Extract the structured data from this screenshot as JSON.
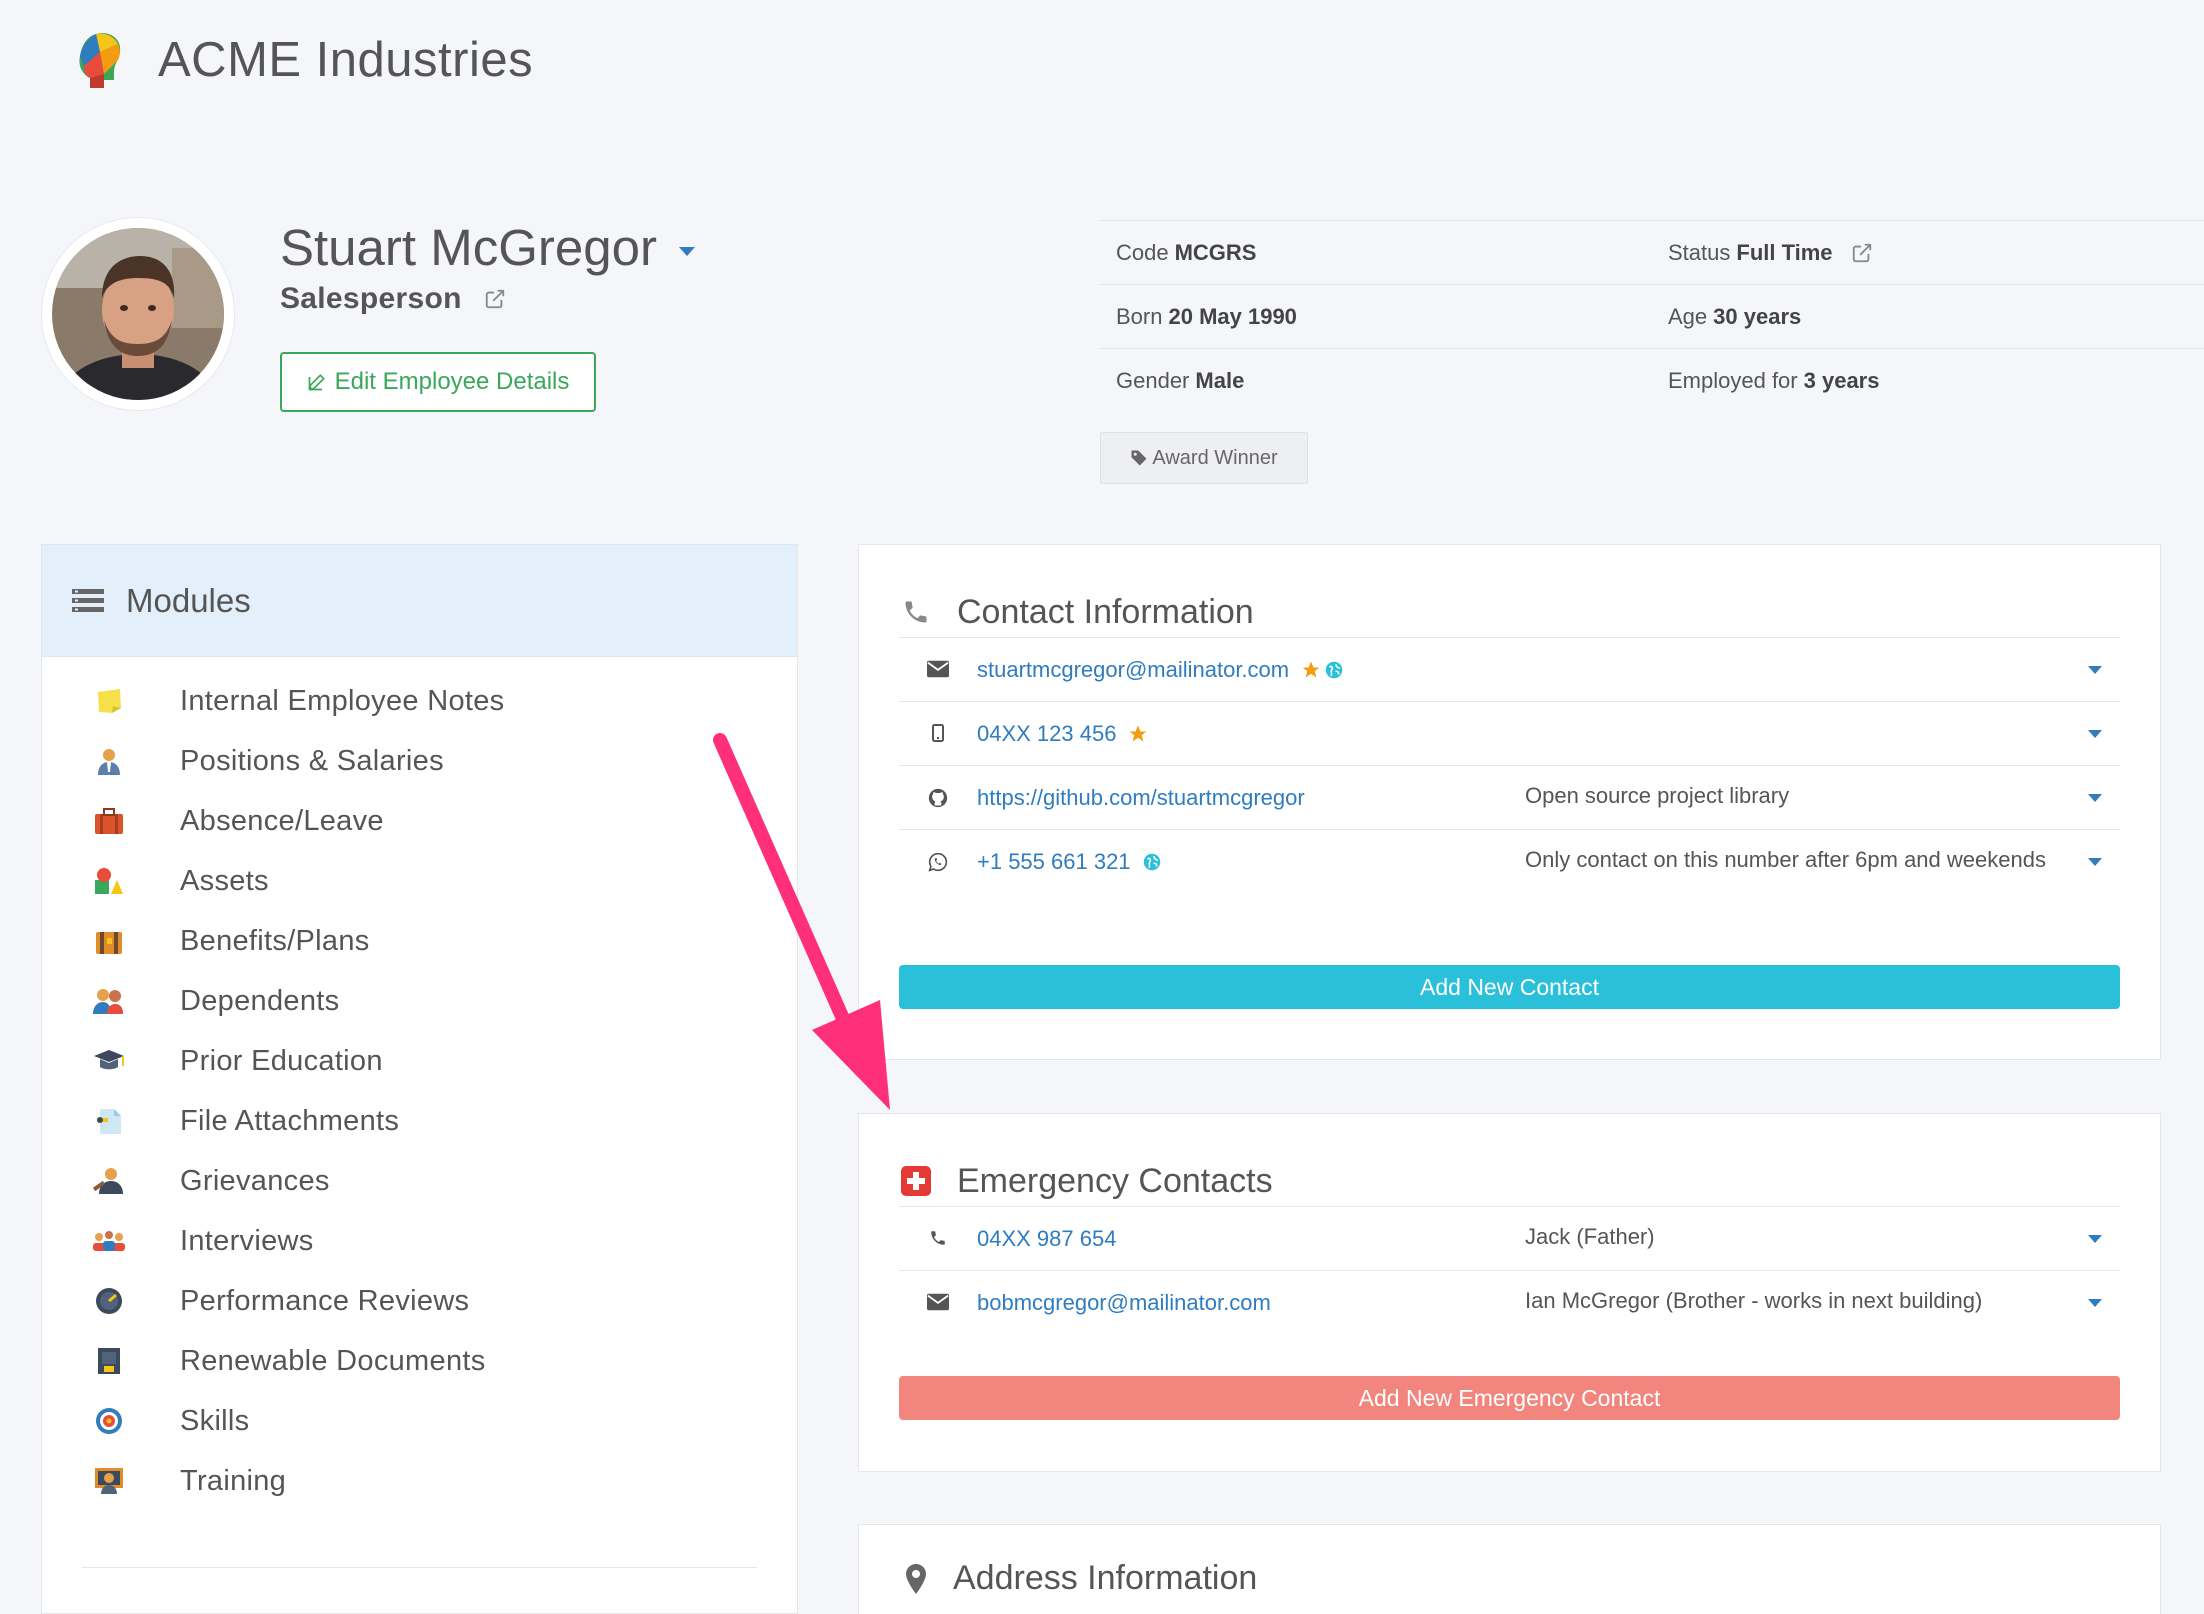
{
  "app": {
    "title": "ACME Industries"
  },
  "employee": {
    "name": "Stuart McGregor",
    "role": "Salesperson",
    "edit_label": "Edit Employee Details"
  },
  "info": {
    "code_label": "Code",
    "code_value": "MCGRS",
    "status_label": "Status",
    "status_value": "Full Time",
    "born_label": "Born",
    "born_value": "20 May 1990",
    "age_label": "Age",
    "age_value": "30 years",
    "gender_label": "Gender",
    "gender_value": "Male",
    "employed_label": "Employed for",
    "employed_value": "3 years",
    "tag": "Award Winner"
  },
  "modules": {
    "title": "Modules",
    "items": [
      {
        "label": "Internal Employee Notes",
        "icon": "sticky-note-icon",
        "color": "#f5e04a"
      },
      {
        "label": "Positions & Salaries",
        "icon": "person-icon",
        "color": "#e8a04a"
      },
      {
        "label": "Absence/Leave",
        "icon": "suitcase-icon",
        "color": "#d9532b"
      },
      {
        "label": "Assets",
        "icon": "blocks-icon",
        "color": "#3aa75a"
      },
      {
        "label": "Benefits/Plans",
        "icon": "chest-icon",
        "color": "#e08c2b"
      },
      {
        "label": "Dependents",
        "icon": "family-icon",
        "color": "#e8a04a"
      },
      {
        "label": "Prior Education",
        "icon": "graduation-cap-icon",
        "color": "#3d4a5c"
      },
      {
        "label": "File Attachments",
        "icon": "attachment-icon",
        "color": "#7fc6e8"
      },
      {
        "label": "Grievances",
        "icon": "judge-icon",
        "color": "#8a5a3a"
      },
      {
        "label": "Interviews",
        "icon": "people-icon",
        "color": "#e8a04a"
      },
      {
        "label": "Performance Reviews",
        "icon": "gauge-icon",
        "color": "#3d4a5c"
      },
      {
        "label": "Renewable Documents",
        "icon": "document-icon",
        "color": "#3d4a5c"
      },
      {
        "label": "Skills",
        "icon": "target-icon",
        "color": "#2f7cbf"
      },
      {
        "label": "Training",
        "icon": "teacher-icon",
        "color": "#e08c2b"
      }
    ]
  },
  "contact": {
    "title": "Contact Information",
    "rows": [
      {
        "icon": "envelope-icon",
        "value": "stuartmcgregor@mailinator.com",
        "note": "",
        "star": true,
        "globe": true
      },
      {
        "icon": "mobile-icon",
        "value": "04XX 123 456",
        "note": "",
        "star": true,
        "globe": false
      },
      {
        "icon": "github-icon",
        "value": "https://github.com/stuartmcgregor",
        "note": "Open source project library",
        "star": false,
        "globe": false
      },
      {
        "icon": "whatsapp-icon",
        "value": "+1 555 661 321",
        "note": "Only contact on this number after 6pm and weekends",
        "star": false,
        "globe": true
      }
    ],
    "add_label": "Add New Contact",
    "add_color": "#2bc0da"
  },
  "emergency": {
    "title": "Emergency Contacts",
    "rows": [
      {
        "icon": "phone-icon",
        "value": "04XX 987 654",
        "note": "Jack (Father)"
      },
      {
        "icon": "envelope-icon",
        "value": "bobmcgregor@mailinator.com",
        "note": "Ian McGregor (Brother - works in next building)"
      }
    ],
    "add_label": "Add New Emergency Contact",
    "add_color": "#f2867e"
  },
  "address": {
    "title": "Address Information"
  }
}
